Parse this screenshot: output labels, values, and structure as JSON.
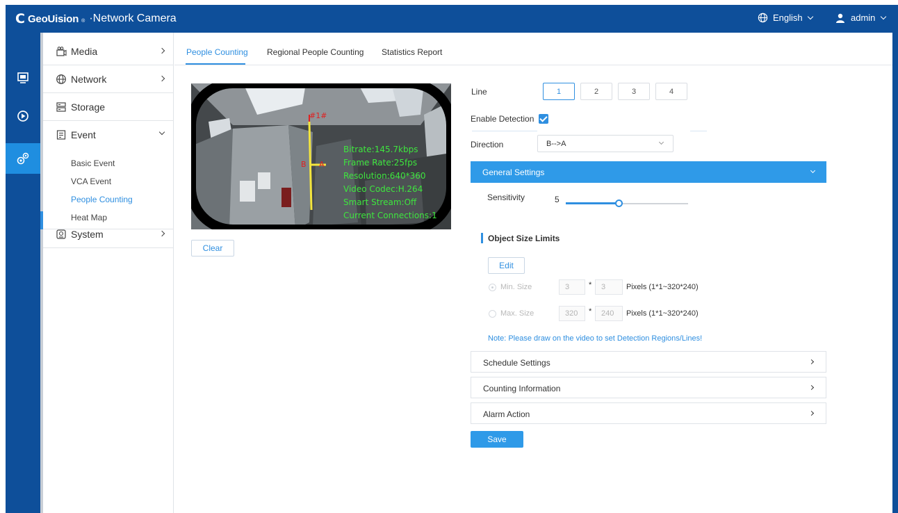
{
  "header": {
    "logo_mark": "C",
    "brand": "GeoUision",
    "brand_tm": "®",
    "product": "·Network Camera",
    "language": "English",
    "user": "admin"
  },
  "rail": {
    "icons": [
      "monitor-icon",
      "playback-icon",
      "settings-gears-icon"
    ]
  },
  "menu": {
    "media": "Media",
    "network": "Network",
    "storage": "Storage",
    "event": "Event",
    "event_subitems": [
      "Basic Event",
      "VCA Event",
      "People Counting",
      "Heat Map"
    ],
    "system": "System"
  },
  "tabs": [
    "People Counting",
    "Regional People Counting",
    "Statistics Report"
  ],
  "video": {
    "line_label": "#1#",
    "point_b": "B",
    "point_a": "A",
    "osd": [
      "Bitrate:145.7kbps",
      "Frame Rate:25fps",
      "Resolution:640*360",
      "Video Codec:H.264",
      "Smart Stream:Off",
      "Current Connections:1"
    ],
    "clear_label": "Clear"
  },
  "settings": {
    "line_label": "Line",
    "lines": [
      "1",
      "2",
      "3",
      "4"
    ],
    "active_line": "1",
    "enable_detection_label": "Enable Detection",
    "enable_detection": true,
    "direction_label": "Direction",
    "direction_value": "B-->A",
    "general_settings_label": "General Settings",
    "sensitivity_label": "Sensitivity",
    "sensitivity_value": "5",
    "sensitivity_fraction": 0.43,
    "object_size_title": "Object Size Limits",
    "edit_label": "Edit",
    "min_size_label": "Min. Size",
    "min_w": "3",
    "min_h": "3",
    "max_size_label": "Max. Size",
    "max_w": "320",
    "max_h": "240",
    "times": "*",
    "pixels_range": "Pixels (1*1~320*240)",
    "note": "Note: Please draw on the video to set Detection Regions/Lines!",
    "schedule_label": "Schedule Settings",
    "counting_label": "Counting Information",
    "alarm_label": "Alarm Action",
    "save_label": "Save"
  },
  "colors": {
    "header_blue": "#0e4f9a",
    "accent": "#2f8fe0",
    "osd_green": "#3ee63e"
  }
}
